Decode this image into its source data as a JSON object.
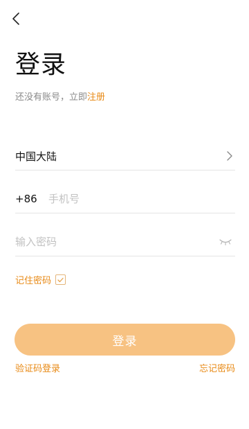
{
  "header": {
    "back_icon": "chevron-left-icon"
  },
  "title": "登录",
  "subtitle": {
    "prefix": "还没有账号，立即",
    "register_link": "注册"
  },
  "region": {
    "value": "中国大陆",
    "icon": "chevron-right-icon"
  },
  "phone": {
    "prefix": "+86",
    "placeholder": "手机号",
    "value": ""
  },
  "password": {
    "placeholder": "输入密码",
    "value": "",
    "icon": "eye-closed-icon"
  },
  "remember": {
    "label": "记住密码",
    "checked": true
  },
  "login_button": {
    "label": "登录",
    "enabled": false
  },
  "links": {
    "sms_login": "验证码登录",
    "forgot_password": "忘记密码"
  },
  "colors": {
    "accent": "#e88a16",
    "button_disabled": "#f7c282",
    "divider": "#e4e4e4",
    "placeholder": "#c2c2c2"
  }
}
